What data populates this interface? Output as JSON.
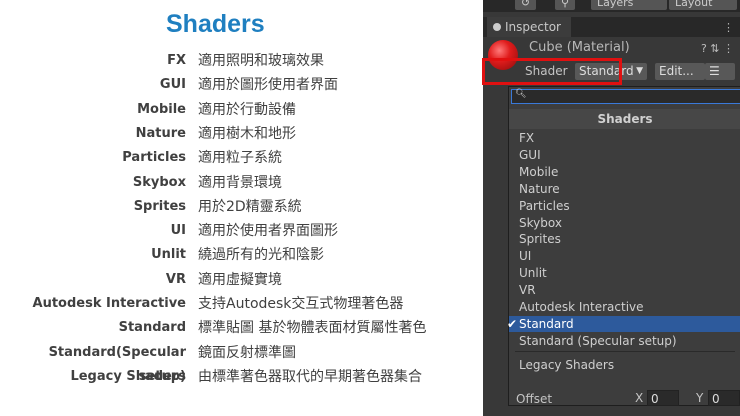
{
  "slide": {
    "title": "Shaders",
    "rows": [
      {
        "key": "FX",
        "value": "適用照明和玻璃效果"
      },
      {
        "key": "GUI",
        "value": "適用於圖形使用者界面"
      },
      {
        "key": "Mobile",
        "value": "適用於行動設備"
      },
      {
        "key": "Nature",
        "value": "適用樹木和地形"
      },
      {
        "key": "Particles",
        "value": "適用粒子系統"
      },
      {
        "key": "Skybox",
        "value": "適用背景環境"
      },
      {
        "key": "Sprites",
        "value": "用於2D精靈系統"
      },
      {
        "key": "UI",
        "value": "適用於使用者界面圖形"
      },
      {
        "key": "Unlit",
        "value": "繞過所有的光和陰影"
      },
      {
        "key": "VR",
        "value": "適用虛擬實境"
      },
      {
        "key": "Autodesk Interactive",
        "value": "支持Autodesk交互式物理著色器"
      },
      {
        "key": "Standard",
        "value": "標準貼圖 基於物體表面材質屬性著色"
      },
      {
        "key": "Standard(Specular setup)",
        "value": "鏡面反射標準圖"
      },
      {
        "key": "Legacy Shaders",
        "value": "由標準著色器取代的早期著色器集合"
      }
    ]
  },
  "topbar": {
    "layers": "Layers",
    "layout": "Layout"
  },
  "inspector": {
    "tab_label": "Inspector",
    "material_name": "Cube (Material)",
    "header_icons": "? ⇅ ⋮",
    "shader_label": "Shader",
    "shader_value": "Standard",
    "edit_label": "Edit...",
    "menu_icon": "☰"
  },
  "popup": {
    "search_value": "",
    "header": "Shaders",
    "items": [
      {
        "label": "FX"
      },
      {
        "label": "GUI"
      },
      {
        "label": "Mobile"
      },
      {
        "label": "Nature"
      },
      {
        "label": "Particles"
      },
      {
        "label": "Skybox"
      },
      {
        "label": "Sprites"
      },
      {
        "label": "UI"
      },
      {
        "label": "Unlit"
      },
      {
        "label": "VR"
      },
      {
        "label": "Autodesk Interactive"
      },
      {
        "label": "Standard",
        "selected": true
      },
      {
        "label": "Standard (Specular setup)"
      }
    ],
    "legacy": "Legacy Shaders"
  },
  "offset": {
    "label": "Offset",
    "x_label": "X",
    "x_value": "0",
    "y_label": "Y",
    "y_value": "0"
  },
  "colors": {
    "accent": "#1f7fc0",
    "selection": "#2d5a9c",
    "highlight": "#e01010"
  }
}
